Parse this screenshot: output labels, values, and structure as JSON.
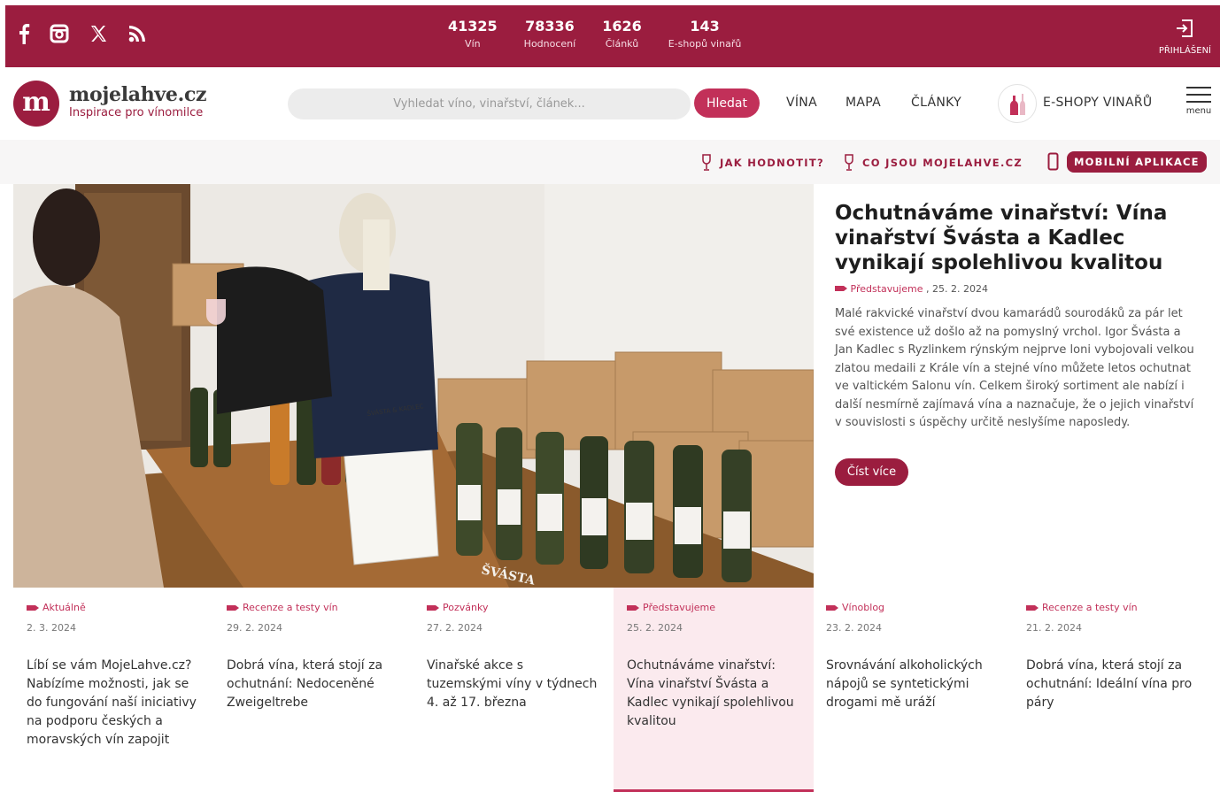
{
  "topbar": {
    "social": [
      {
        "icon": "facebook-icon"
      },
      {
        "icon": "instagram-icon"
      },
      {
        "icon": "x-icon"
      },
      {
        "icon": "rss-icon"
      }
    ],
    "stats": [
      {
        "num": "41325",
        "label": "Vín"
      },
      {
        "num": "78336",
        "label": "Hodnocení"
      },
      {
        "num": "1626",
        "label": "Článků"
      },
      {
        "num": "143",
        "label": "E-shopů vinařů"
      }
    ],
    "login_label": "PŘIHLÁŠENÍ"
  },
  "header": {
    "logo_letter": "m",
    "logo_name": "mojelahve.cz",
    "logo_tag": "Inspirace pro vínomilce",
    "search_placeholder": "Vyhledat víno, vinařství, článek...",
    "search_button": "Hledat",
    "nav": [
      "VÍNA",
      "MAPA",
      "ČLÁNKY"
    ],
    "eshops": "E-SHOPY VINAŘŮ",
    "menu_label": "menu"
  },
  "subbar": {
    "how_to_rate": "JAK HODNOTIT?",
    "what_is": "CO JSOU MOJELAHVE.CZ",
    "mobile_app": "MOBILNÍ APLIKACE"
  },
  "hero": {
    "title": "Ochutnáváme vinařství: Vína vinařství Švásta a Kadlec vynikají spolehlivou kvalitou",
    "category": "Představujeme",
    "date": ", 25. 2. 2024",
    "excerpt": "Malé rakvické vinařství dvou kamarádů sourodáků za pár let své existence už došlo až na pomyslný vrchol. Igor Švásta a Jan Kadlec s Ryzlinkem rýnským nejprve loni vybojovali velkou zlatou medaili z Krále vín a stejné víno můžete letos ochutnat ve valtickém Salonu vín. Celkem široký sortiment ale nabízí i další nesmírně zajímavá vína a naznačuje, že o jejich vinařství v souvislosti s úspěchy určitě neslyšíme naposledy.",
    "read_more": "Číst více",
    "image_labels": {
      "brand": "ŠVÁSTA",
      "brand_kadlec": "ŠVÁSTA & KADLEC"
    }
  },
  "cards": [
    {
      "category": "Aktuálně",
      "date": "2. 3. 2024",
      "title": "Líbí se vám MojeLahve.cz? Nabízíme možnosti, jak se do fungování naší iniciativy na podporu českých a moravských vín zapojit"
    },
    {
      "category": "Recenze a testy vín",
      "date": "29. 2. 2024",
      "title": "Dobrá vína, která stojí za ochutnání: Nedoceněné Zweigeltrebe"
    },
    {
      "category": "Pozvánky",
      "date": "27. 2. 2024",
      "title": "Vinařské akce s tuzemskými víny v týdnech 4. až 17. března"
    },
    {
      "category": "Představujeme",
      "date": "25. 2. 2024",
      "title": "Ochutnáváme vinařství: Vína vinařství Švásta a Kadlec vynikají spolehlivou kvalitou"
    },
    {
      "category": "Vínoblog",
      "date": "23. 2. 2024",
      "title": "Srovnávání alkoholických nápojů se syntetickými drogami mě uráží"
    },
    {
      "category": "Recenze a testy vín",
      "date": "21. 2. 2024",
      "title": "Dobrá vína, která stojí za ochutnání: Ideální vína pro páry"
    }
  ],
  "colors": {
    "brand": "#9b1d3f",
    "accent": "#c23059",
    "active_card": "#fbeaee"
  }
}
